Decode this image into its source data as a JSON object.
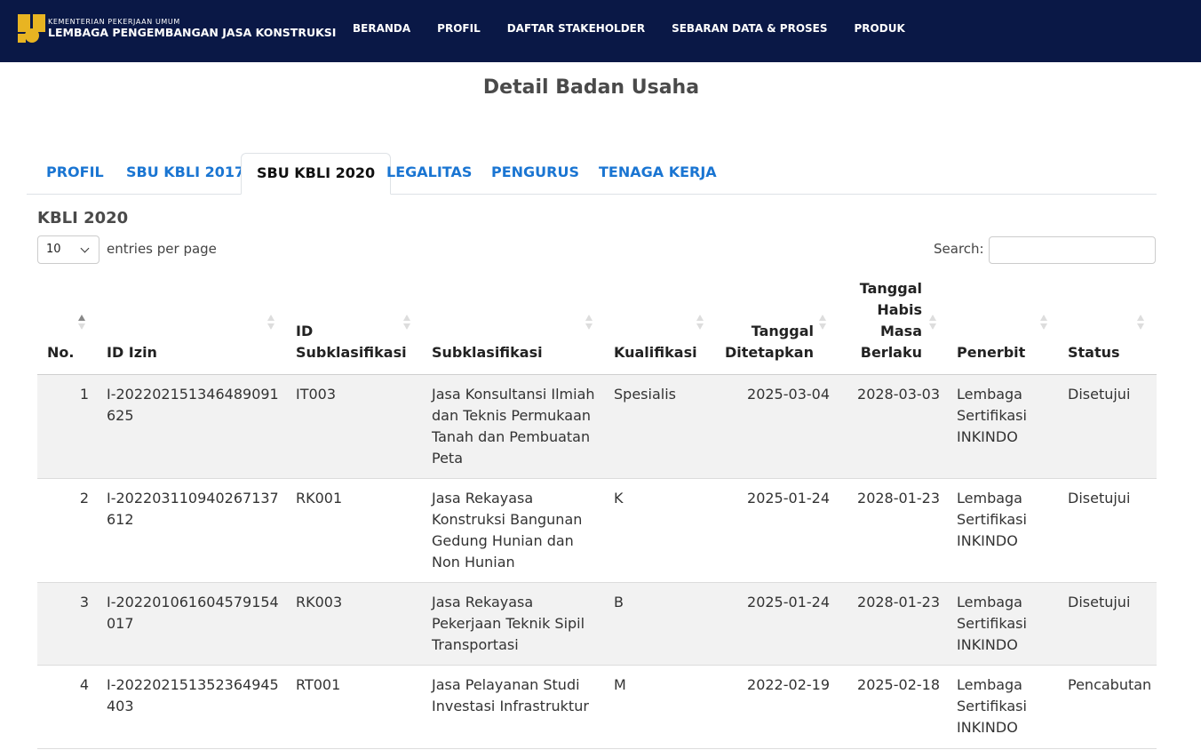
{
  "header": {
    "org_small": "KEMENTERIAN PEKERJAAN UMUM",
    "org_big": "LEMBAGA PENGEMBANGAN JASA KONSTRUKSI",
    "nav": [
      "BERANDA",
      "PROFIL",
      "DAFTAR STAKEHOLDER",
      "SEBARAN DATA & PROSES",
      "PRODUK"
    ]
  },
  "page": {
    "title": "Detail Badan Usaha"
  },
  "tabs": {
    "active": "SBU KBLI 2020",
    "items": [
      "PROFIL",
      "SBU KBLI 2017",
      "SBU KBLI 2020",
      "LEGALITAS",
      "PENGURUS",
      "TENAGA KERJA"
    ]
  },
  "section": {
    "title": "KBLI 2020"
  },
  "controls": {
    "entries_value": "10",
    "entries_label": "entries per page",
    "search_label": "Search:",
    "search_value": ""
  },
  "table": {
    "headers": {
      "no": "No.",
      "id_izin": "ID Izin",
      "id_subklasifikasi": "ID Subklasifikasi",
      "subklasifikasi": "Subklasifikasi",
      "kualifikasi": "Kualifikasi",
      "tanggal_ditetapkan": "Tanggal Ditetapkan",
      "tanggal_habis": "Tanggal Habis Masa Berlaku",
      "penerbit": "Penerbit",
      "status": "Status"
    },
    "rows": [
      {
        "no": "1",
        "id_izin": "I-202202151346489091625",
        "id_sub": "IT003",
        "subklasifikasi": "Jasa Konsultansi Ilmiah dan Teknis Permukaan Tanah dan Pembuatan Peta",
        "kualifikasi": "Spesialis",
        "ditetapkan": "2025-03-04",
        "habis": "2028-03-03",
        "penerbit": "Lembaga Sertifikasi INKINDO",
        "status": "Disetujui"
      },
      {
        "no": "2",
        "id_izin": "I-202203110940267137612",
        "id_sub": "RK001",
        "subklasifikasi": "Jasa Rekayasa Konstruksi Bangunan Gedung Hunian dan Non Hunian",
        "kualifikasi": "K",
        "ditetapkan": "2025-01-24",
        "habis": "2028-01-23",
        "penerbit": "Lembaga Sertifikasi INKINDO",
        "status": "Disetujui"
      },
      {
        "no": "3",
        "id_izin": "I-202201061604579154017",
        "id_sub": "RK003",
        "subklasifikasi": "Jasa Rekayasa Pekerjaan Teknik Sipil Transportasi",
        "kualifikasi": "B",
        "ditetapkan": "2025-01-24",
        "habis": "2028-01-23",
        "penerbit": "Lembaga Sertifikasi INKINDO",
        "status": "Disetujui"
      },
      {
        "no": "4",
        "id_izin": "I-202202151352364945403",
        "id_sub": "RT001",
        "subklasifikasi": "Jasa Pelayanan Studi Investasi Infrastruktur",
        "kualifikasi": "M",
        "ditetapkan": "2022-02-19",
        "habis": "2025-02-18",
        "penerbit": "Lembaga Sertifikasi INKINDO",
        "status": "Pencabutan"
      }
    ]
  }
}
